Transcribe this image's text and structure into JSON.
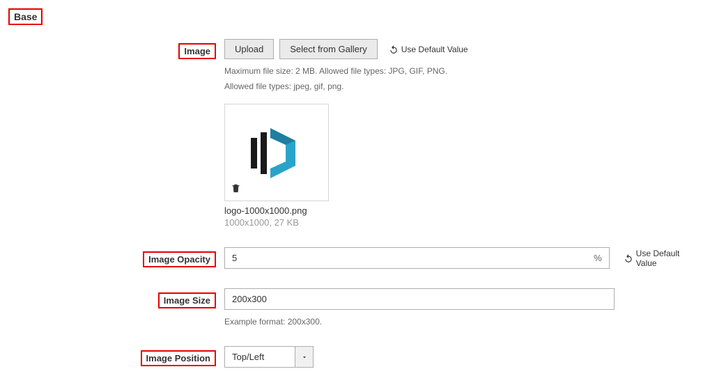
{
  "section_title": "Base",
  "image": {
    "label": "Image",
    "upload_label": "Upload",
    "gallery_label": "Select from Gallery",
    "reset_label": "Use Default Value",
    "help1": "Maximum file size: 2 MB. Allowed file types: JPG, GIF, PNG.",
    "help2": "Allowed file types: jpeg, gif, png.",
    "file_name": "logo-1000x1000.png",
    "file_meta": "1000x1000, 27 KB"
  },
  "opacity": {
    "label": "Image Opacity",
    "value": "5",
    "suffix": "%",
    "reset_label": "Use Default Value"
  },
  "size": {
    "label": "Image Size",
    "value": "200x300",
    "help": "Example format: 200x300."
  },
  "position": {
    "label": "Image Position",
    "value": "Top/Left"
  }
}
